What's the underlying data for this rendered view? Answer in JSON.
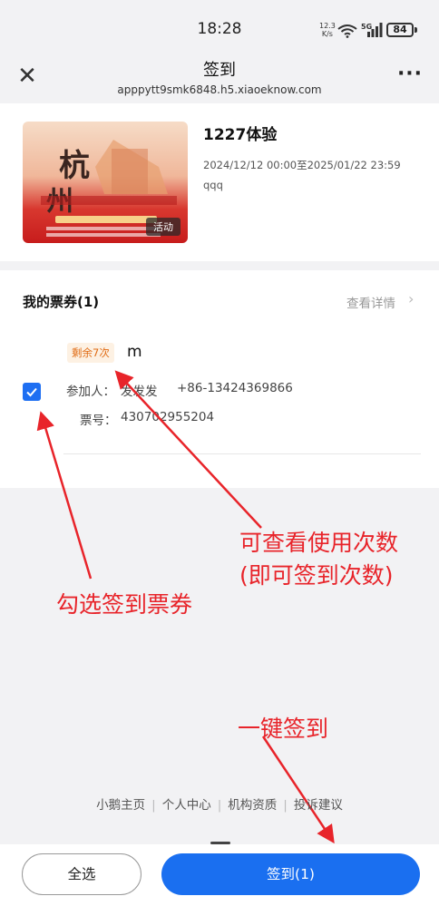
{
  "status_bar": {
    "time": "18:28",
    "net_speed_value": "12.3",
    "net_speed_unit": "K/s",
    "network": "5G",
    "battery": "84"
  },
  "nav": {
    "title": "签到",
    "url": "apppytt9smk6848.h5.xiaoeknow.com",
    "close_icon": "close-icon",
    "more_icon": "more-icon"
  },
  "event": {
    "title": "1227体验",
    "time_range": "2024/12/12 00:00至2025/01/22 23:59",
    "description": "qqq",
    "poster_tag": "活动"
  },
  "tickets": {
    "section_title": "我的票券(1)",
    "view_details": "查看详情",
    "items": [
      {
        "remaining_badge": "剩余7次",
        "name": "m",
        "checked": true,
        "attendee_label": "参加人：",
        "attendee_name": "发发发",
        "attendee_phone": "+86-13424369866",
        "ticket_no_label": "票号：",
        "ticket_no": "430702955204"
      }
    ]
  },
  "footer": {
    "links": [
      "小鹅主页",
      "个人中心",
      "机构资质",
      "投诉建议"
    ]
  },
  "bottom_bar": {
    "select_all": "全选",
    "checkin_button": "签到(1)"
  },
  "annotations": {
    "usage_line1": "可查看使用次数",
    "usage_line2": "(即可签到次数)",
    "check_ticket": "勾选签到票券",
    "one_click": "一键签到",
    "color": "#e8242a"
  },
  "colors": {
    "primary": "#1a6ff0",
    "badge_text": "#e06a12",
    "badge_bg": "#fdf1e3"
  }
}
